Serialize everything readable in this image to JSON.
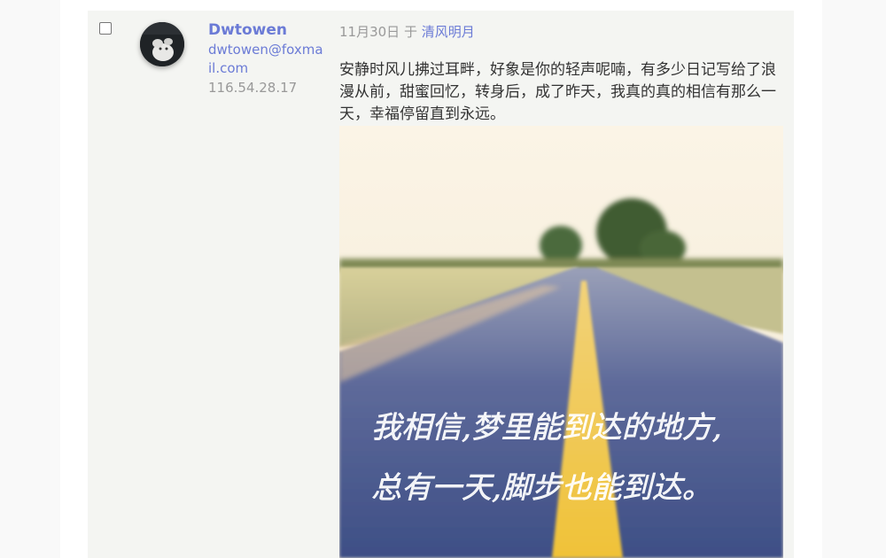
{
  "comment": {
    "author": {
      "name": "Dwtowen",
      "email": "dwtowen@foxmail.com",
      "ip": "116.54.28.17"
    },
    "date": "11月30日",
    "on_label": "于",
    "post_title": "清风明月",
    "text": "安静时风儿拂过耳畔，好象是你的轻声呢喃，有多少日记写给了浪漫从前，甜蜜回忆，转身后，成了昨天，我真的真的相信有那么一天，幸福停留直到永远。",
    "image": {
      "subject": "photo of a road stretching into the distance",
      "handwriting_line1": "我相信,梦里能到达的地方,",
      "handwriting_line2": "总有一天,脚步也能到达。"
    }
  }
}
